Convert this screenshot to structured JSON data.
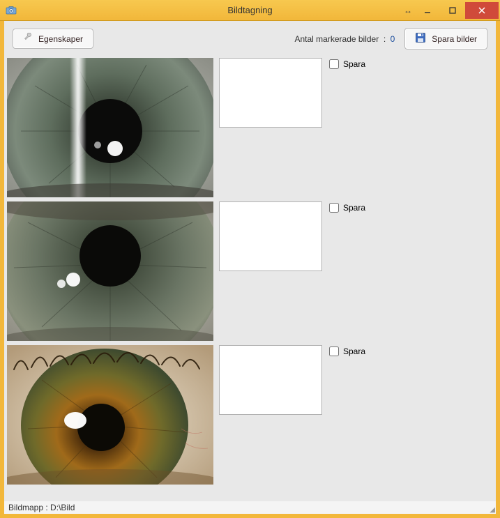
{
  "window": {
    "title": "Bildtagning"
  },
  "toolbar": {
    "properties_label": "Egenskaper",
    "marked_label": "Antal markerade bilder",
    "marked_separator": ":",
    "marked_count": "0",
    "save_images_label": "Spara bilder"
  },
  "rows": [
    {
      "save_label": "Spara",
      "checked": false
    },
    {
      "save_label": "Spara",
      "checked": false
    },
    {
      "save_label": "Spara",
      "checked": false
    }
  ],
  "statusbar": {
    "folder_label": "Bildmapp :",
    "folder_path": "D:\\Bild"
  },
  "icons": {
    "camera": "camera-icon",
    "wrench": "wrench-icon",
    "disk": "disk-icon",
    "resize_h": "resize-horizontal-icon",
    "minimize": "minimize-icon",
    "maximize": "maximize-icon",
    "close": "close-icon"
  }
}
